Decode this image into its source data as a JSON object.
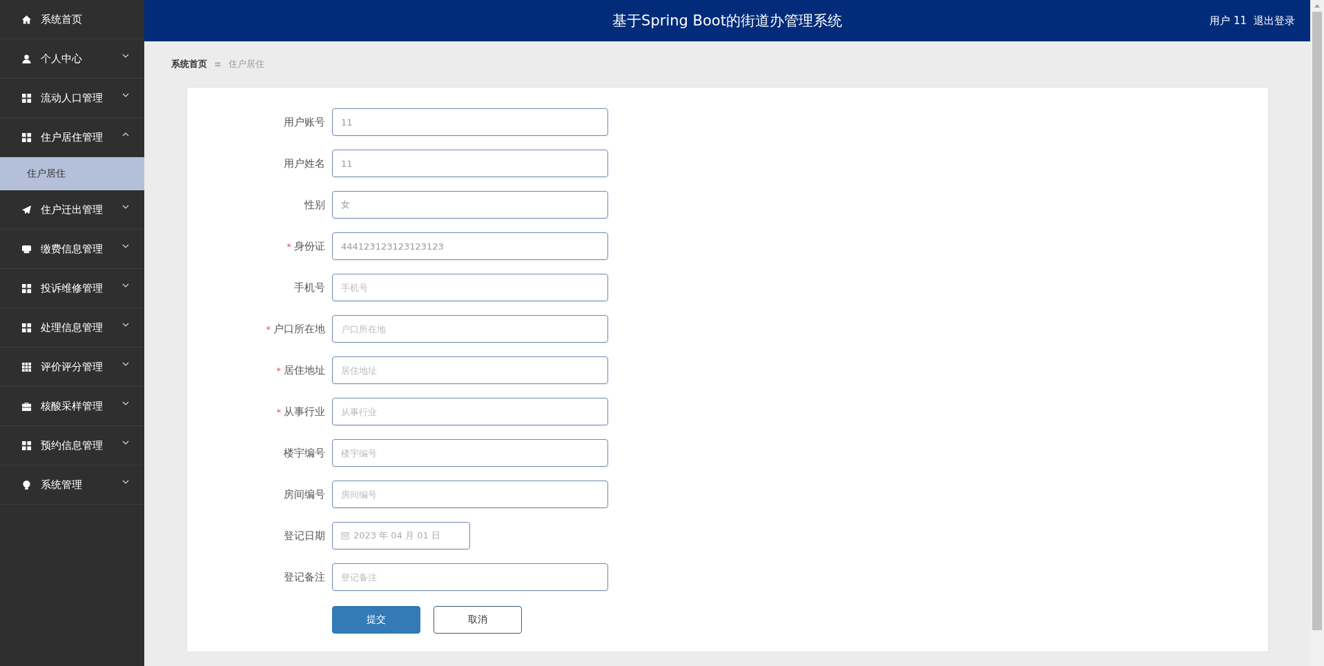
{
  "sidebar": {
    "items": [
      {
        "label": "系统首页"
      },
      {
        "label": "个人中心",
        "expanded": false
      },
      {
        "label": "流动人口管理",
        "expanded": false
      },
      {
        "label": "住户居住管理",
        "expanded": true,
        "children": [
          {
            "label": "住户居住",
            "selected": true
          }
        ]
      },
      {
        "label": "住户迁出管理",
        "expanded": false
      },
      {
        "label": "缴费信息管理",
        "expanded": false
      },
      {
        "label": "投诉维修管理",
        "expanded": false
      },
      {
        "label": "处理信息管理",
        "expanded": false
      },
      {
        "label": "评价评分管理",
        "expanded": false
      },
      {
        "label": "核酸采样管理",
        "expanded": false
      },
      {
        "label": "预约信息管理",
        "expanded": false
      },
      {
        "label": "系统管理",
        "expanded": false
      }
    ]
  },
  "header": {
    "title": "基于Spring Boot的街道办管理系统",
    "user": "用户 11",
    "logout": "退出登录"
  },
  "breadcrumb": [
    "系统首页",
    "住户居住"
  ],
  "breadcrumb_separator": "〓",
  "form": {
    "fields": [
      {
        "label": "用户账号",
        "required": false,
        "kind": "text",
        "value": "11"
      },
      {
        "label": "用户姓名",
        "required": false,
        "kind": "text",
        "value": "11"
      },
      {
        "label": "性别",
        "required": false,
        "kind": "text",
        "value": "女"
      },
      {
        "label": "身份证",
        "required": true,
        "kind": "text",
        "value": "444123123123123123"
      },
      {
        "label": "手机号",
        "required": false,
        "kind": "text",
        "placeholder": "手机号"
      },
      {
        "label": "户口所在地",
        "required": true,
        "kind": "text",
        "placeholder": "户口所在地"
      },
      {
        "label": "居住地址",
        "required": true,
        "kind": "text",
        "placeholder": "居住地址"
      },
      {
        "label": "从事行业",
        "required": true,
        "kind": "text",
        "placeholder": "从事行业"
      },
      {
        "label": "楼宇编号",
        "required": false,
        "kind": "text",
        "placeholder": "楼宇编号"
      },
      {
        "label": "房间编号",
        "required": false,
        "kind": "text",
        "placeholder": "房间编号"
      },
      {
        "label": "登记日期",
        "required": false,
        "kind": "date",
        "value": "2023 年 04 月 01 日"
      },
      {
        "label": "登记备注",
        "required": false,
        "kind": "text",
        "placeholder": "登记备注"
      }
    ],
    "required_mark": "*",
    "buttons": [
      {
        "label": "提交",
        "kind": "primary"
      },
      {
        "label": "取消",
        "kind": "default"
      }
    ]
  }
}
